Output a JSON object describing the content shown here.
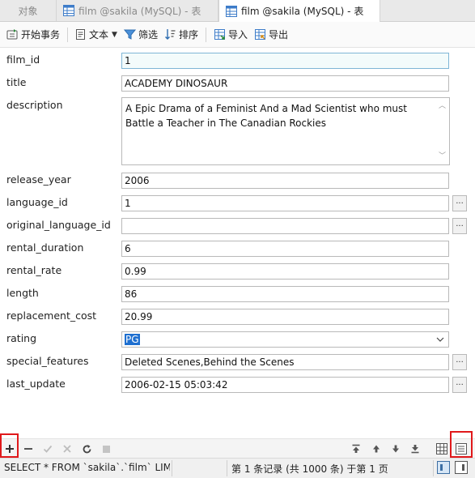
{
  "tabs": [
    {
      "label": "对象",
      "active": false
    },
    {
      "label": "film @sakila (MySQL) - 表",
      "active": false
    },
    {
      "label": "film @sakila (MySQL) - 表",
      "active": true
    }
  ],
  "toolbar": {
    "begin_transaction": "开始事务",
    "text": "文本",
    "filter": "筛选",
    "sort": "排序",
    "import": "导入",
    "export": "导出"
  },
  "fields": [
    {
      "name": "film_id",
      "value": "1"
    },
    {
      "name": "title",
      "value": "ACADEMY DINOSAUR"
    },
    {
      "name": "description",
      "value": "A Epic Drama of a Feminist And a Mad Scientist who must Battle a Teacher in The Canadian Rockies"
    },
    {
      "name": "release_year",
      "value": "2006"
    },
    {
      "name": "language_id",
      "value": "1"
    },
    {
      "name": "original_language_id",
      "value": ""
    },
    {
      "name": "rental_duration",
      "value": "6"
    },
    {
      "name": "rental_rate",
      "value": "0.99"
    },
    {
      "name": "length",
      "value": "86"
    },
    {
      "name": "replacement_cost",
      "value": "20.99"
    },
    {
      "name": "rating",
      "value": "PG"
    },
    {
      "name": "special_features",
      "value": "Deleted Scenes,Behind the Scenes"
    },
    {
      "name": "last_update",
      "value": "2006-02-15 05:03:42"
    }
  ],
  "ellipsis_label": "...",
  "status": {
    "sql": "SELECT * FROM `sakila`.`film` LIMIT",
    "record": "第 1 条记录 (共 1000 条) 于第 1 页"
  },
  "colors": {
    "highlight_box": "#e0191b",
    "selection": "#1e6fd0",
    "accent": "#3c6ea3"
  },
  "icons": {
    "tab_table": "table-icon",
    "nav_add": "plus-icon",
    "nav_delete": "minus-icon",
    "nav_apply": "check-icon",
    "nav_discard": "cross-icon",
    "nav_refresh": "refresh-icon",
    "nav_stop": "stop-icon",
    "nav_first": "first-record-icon",
    "nav_prev": "previous-record-icon",
    "nav_next": "next-record-icon",
    "nav_last": "last-record-icon",
    "grid_view": "grid-view-icon",
    "form_view": "form-view-icon"
  }
}
